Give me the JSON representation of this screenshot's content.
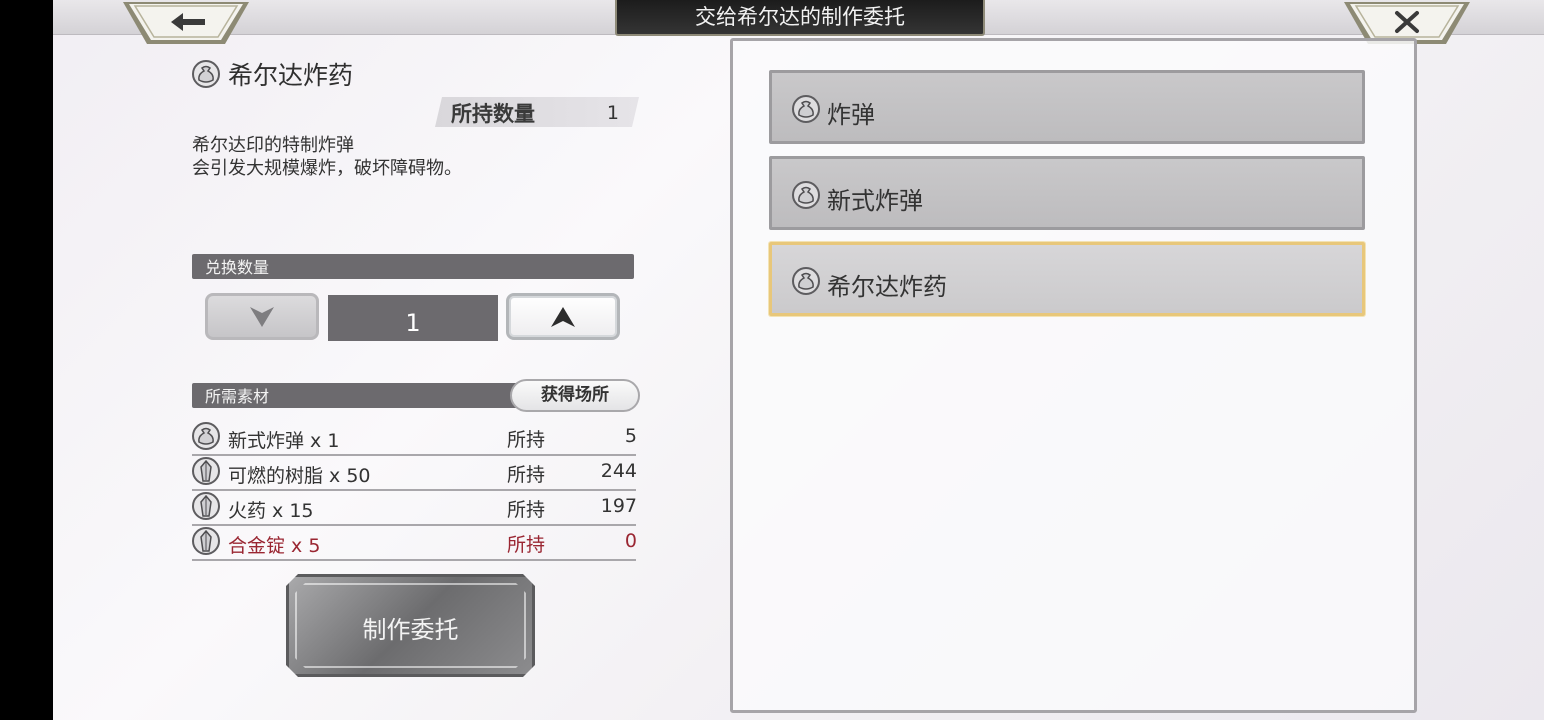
{
  "header": {
    "title": "交给希尔达的制作委托",
    "back_icon": "arrow-left-icon",
    "close_icon": "close-icon"
  },
  "item": {
    "name": "希尔达炸药",
    "owned_label": "所持数量",
    "owned_count": "1",
    "description": "希尔达印的特制炸弹\n会引发大规模爆炸，破坏障碍物。"
  },
  "exchange": {
    "label": "兑换数量",
    "value": "1"
  },
  "materials": {
    "label": "所需素材",
    "source_button": "获得场所",
    "rows": [
      {
        "name": "新式炸弹 x 1",
        "own_label": "所持",
        "count": "5",
        "icon": "bag-icon",
        "lacking": false
      },
      {
        "name": "可燃的树脂 x 50",
        "own_label": "所持",
        "count": "244",
        "icon": "crystal-icon",
        "lacking": false
      },
      {
        "name": "火药 x 15",
        "own_label": "所持",
        "count": "197",
        "icon": "crystal-icon",
        "lacking": false
      },
      {
        "name": "合金锭 x 5",
        "own_label": "所持",
        "count": "0",
        "icon": "crystal-icon",
        "lacking": true
      }
    ]
  },
  "craft_button": "制作委托",
  "recipe_list": [
    {
      "name": "炸弹",
      "selected": false
    },
    {
      "name": "新式炸弹",
      "selected": false
    },
    {
      "name": "希尔达炸药",
      "selected": true
    }
  ],
  "colors": {
    "lacking_text": "#9a2632",
    "selected_border": "#e8c77a",
    "bar_dark": "#6c6a6e"
  }
}
